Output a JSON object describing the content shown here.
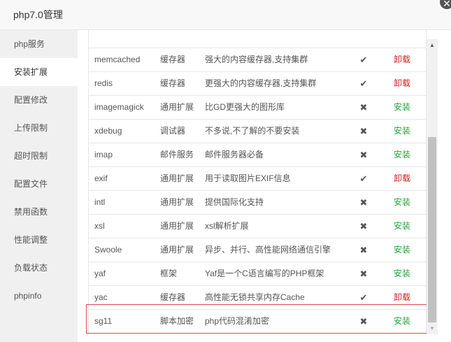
{
  "window": {
    "title": "php7.0管理",
    "close_glyph": "✕"
  },
  "sidebar": {
    "items": [
      {
        "label": "php服务",
        "active": false
      },
      {
        "label": "安装扩展",
        "active": true
      },
      {
        "label": "配置修改",
        "active": false
      },
      {
        "label": "上传限制",
        "active": false
      },
      {
        "label": "超时限制",
        "active": false
      },
      {
        "label": "配置文件",
        "active": false
      },
      {
        "label": "禁用函数",
        "active": false
      },
      {
        "label": "性能调整",
        "active": false
      },
      {
        "label": "负载状态",
        "active": false
      },
      {
        "label": "phpinfo",
        "active": false
      }
    ]
  },
  "extensions": {
    "rows": [
      {
        "name": "memcached",
        "type": "缓存器",
        "desc": "强大的内容缓存器,支持集群",
        "installed": true,
        "status_icon": "✔",
        "op": "卸载"
      },
      {
        "name": "redis",
        "type": "缓存器",
        "desc": "更强大的内容缓存器,支持集群",
        "installed": true,
        "status_icon": "✔",
        "op": "卸载"
      },
      {
        "name": "imagemagick",
        "type": "通用扩展",
        "desc": "比GD更强大的图形库",
        "installed": false,
        "status_icon": "✖",
        "op": "安装"
      },
      {
        "name": "xdebug",
        "type": "调试器",
        "desc": "不多说,不了解的不要安装",
        "installed": false,
        "status_icon": "✖",
        "op": "安装"
      },
      {
        "name": "imap",
        "type": "邮件服务",
        "desc": "邮件服务器必备",
        "installed": false,
        "status_icon": "✖",
        "op": "安装"
      },
      {
        "name": "exif",
        "type": "通用扩展",
        "desc": "用于读取图片EXIF信息",
        "installed": true,
        "status_icon": "✔",
        "op": "卸载"
      },
      {
        "name": "intl",
        "type": "通用扩展",
        "desc": "提供国际化支持",
        "installed": false,
        "status_icon": "✖",
        "op": "安装"
      },
      {
        "name": "xsl",
        "type": "通用扩展",
        "desc": "xsl解析扩展",
        "installed": false,
        "status_icon": "✖",
        "op": "安装"
      },
      {
        "name": "Swoole",
        "type": "通用扩展",
        "desc": "异步、并行、高性能网络通信引擎",
        "installed": false,
        "status_icon": "✖",
        "op": "安装"
      },
      {
        "name": "yaf",
        "type": "框架",
        "desc": "Yaf是一个C语言编写的PHP框架",
        "installed": false,
        "status_icon": "✖",
        "op": "安装"
      },
      {
        "name": "yac",
        "type": "缓存器",
        "desc": "高性能无锁共享内存Cache",
        "installed": true,
        "status_icon": "✔",
        "op": "卸载"
      },
      {
        "name": "sg11",
        "type": "脚本加密",
        "desc": "php代码混淆加密",
        "installed": false,
        "status_icon": "✖",
        "op": "安装"
      }
    ]
  },
  "colors": {
    "uninstall": "#d42020",
    "install": "#20a53a",
    "highlight": "#e04a4a"
  }
}
